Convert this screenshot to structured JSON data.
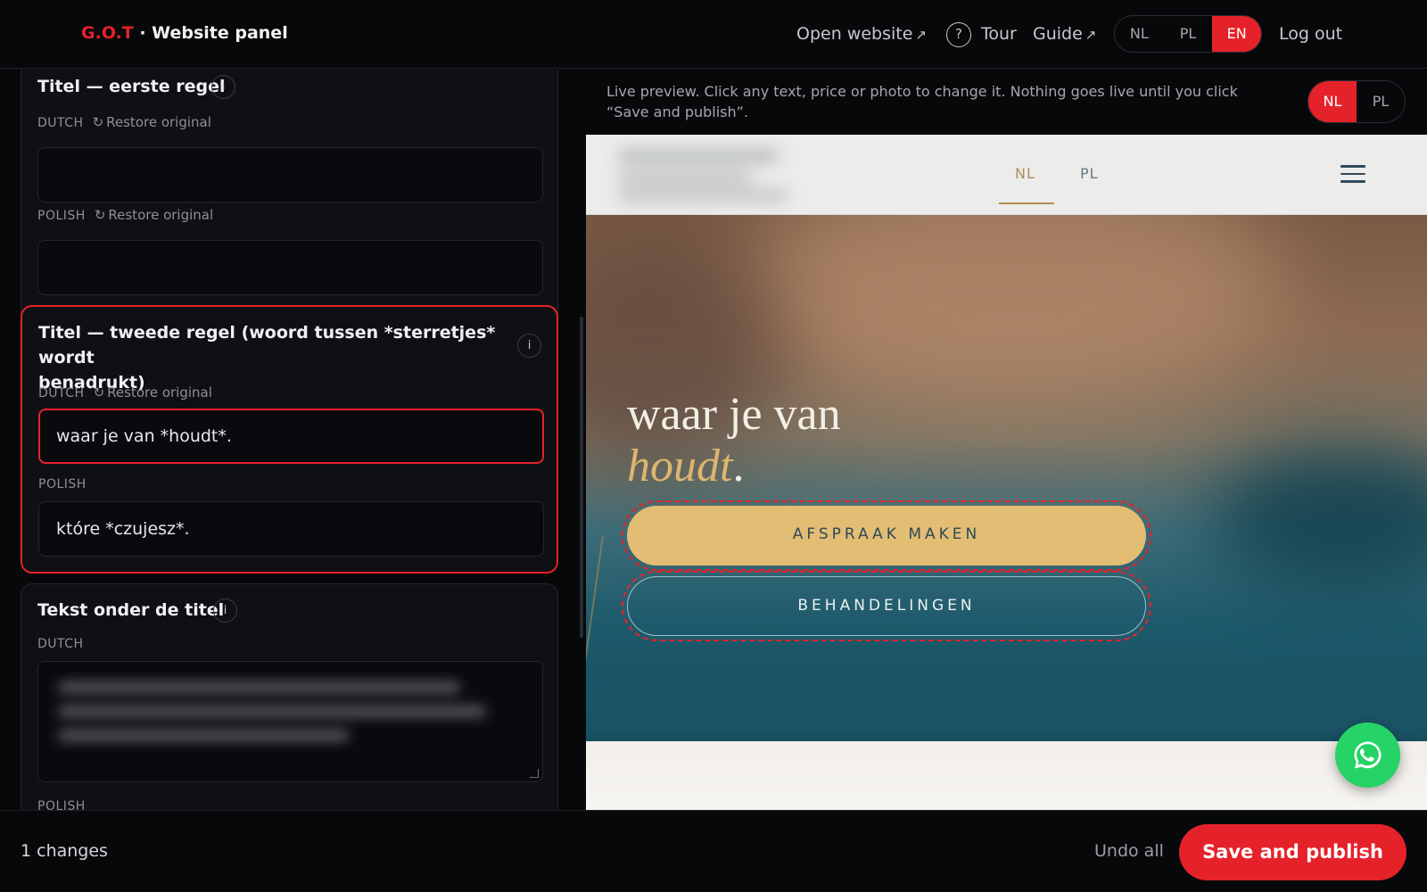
{
  "header": {
    "brand_code": "G.O.T",
    "brand_title": " · Website panel",
    "open_website": "Open website",
    "tour": "Tour",
    "tour_icon": "?",
    "guide": "Guide",
    "arrow": "↗",
    "languages": [
      "NL",
      "PL",
      "EN"
    ],
    "active_language": "EN",
    "logout": "Log out"
  },
  "editor": {
    "fields": [
      {
        "title": "Titel — eerste regel",
        "dutch_label": "DUTCH",
        "polish_label": "POLISH",
        "restore": "Restore original",
        "dutch_value": "",
        "polish_value": ""
      },
      {
        "title_line1": "Titel — tweede regel (woord tussen *sterretjes* wordt",
        "title_line2": "benadrukt)",
        "dutch_label": "DUTCH",
        "polish_label": "POLISH",
        "restore": "Restore original",
        "dutch_value": "waar je van *houdt*.",
        "polish_value": "które *czujesz*."
      },
      {
        "title": "Tekst onder de titel",
        "dutch_label": "DUTCH",
        "polish_label": "POLISH"
      }
    ],
    "info_icon": "i",
    "restore_icon": "↻"
  },
  "preview": {
    "note": "Live preview. Click any text, price or photo to change it. Nothing goes live until you click “Save and publish”.",
    "languages": [
      "NL",
      "PL"
    ],
    "active_language": "NL",
    "site": {
      "nav_languages": [
        "NL",
        "PL"
      ],
      "hero_line1": "waar je van",
      "hero_accent": "houdt",
      "hero_period": ".",
      "primary_button": "AFSPRAAK MAKEN",
      "secondary_button": "BEHANDELINGEN"
    }
  },
  "footer": {
    "changes": "1 changes",
    "undo": "Undo all",
    "publish": "Save and publish"
  },
  "colors": {
    "accent": "#e5222a",
    "gold": "#dcb56f",
    "whatsapp": "#25d366"
  },
  "icons": [
    "external-link-icon",
    "help-circle-icon",
    "info-icon",
    "restore-icon",
    "hamburger-menu-icon",
    "whatsapp-icon",
    "resize-handle-icon"
  ]
}
